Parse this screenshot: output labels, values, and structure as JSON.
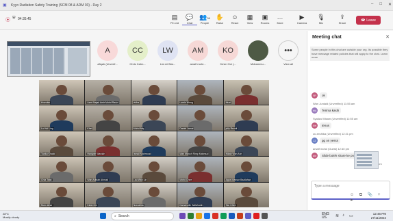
{
  "window": {
    "title": "Kyyo Radiation Safety Training (SCM 08 & ADM 03) - Day 2",
    "min": "–",
    "max": "□",
    "close": "✕"
  },
  "toolbar": {
    "timer": "04:35:45",
    "buttons": [
      {
        "label": "Pin vid",
        "icon": "▤"
      },
      {
        "label": "Chat",
        "icon": "💬"
      },
      {
        "label": "People",
        "icon": "👥"
      },
      {
        "label": "Raise",
        "icon": "✋"
      },
      {
        "label": "React",
        "icon": "☺"
      },
      {
        "label": "View",
        "icon": "▦"
      },
      {
        "label": "Rooms",
        "icon": "▣"
      },
      {
        "label": "More",
        "icon": "…"
      },
      {
        "label": "Camera",
        "icon": "▶"
      },
      {
        "label": "Mic",
        "icon": "🎙"
      },
      {
        "label": "Share",
        "icon": "⇪"
      }
    ],
    "people_count": "36",
    "leave_label": "Leave"
  },
  "avatars": [
    {
      "initials": "A",
      "name": "afiqah (Unverif...",
      "color": "#f8d9d9"
    },
    {
      "initials": "CC",
      "name": "Chris Cahn...",
      "color": "#e4efc9"
    },
    {
      "initials": "LW",
      "name": "Lim Ai War...",
      "color": "#dfe3f3"
    },
    {
      "initials": "AM",
      "name": "amalf mohr...",
      "color": "#f6d8d6"
    },
    {
      "initials": "KO",
      "name": "Kevin Ooi (...",
      "color": "#f6d8d6"
    },
    {
      "initials": "",
      "name": "Mohammu...",
      "color": "#4e5a45"
    },
    {
      "initials": "•••",
      "name": "View all",
      "color": "#f5f5f5"
    }
  ],
  "tiles": [
    "khurulsh",
    "Azmi Najak Amir Mohd Radzi",
    "vidha",
    "Lumin Wong",
    "Muxi",
    "Lu Hui Ling",
    "Khei",
    "Mohd Afiq",
    "Daniel Jamal",
    "juliy Rezidi",
    "Tunku Khalid",
    "Haniyah Wardah",
    "Ismail Mahmood",
    "Man Manoh Rimp Mahmud",
    "Nikah Wan Ann",
    "Chia Tsan",
    "Wan Adibah Ahmad",
    "Lau Wan Lin",
    "Mohd Chee",
    "Agus Mansor Bazilahan",
    "Mun Jahar",
    "Kirah Din",
    "Nurzalina",
    "Kamarudin Sallahudin",
    "Tan Chee"
  ],
  "chat": {
    "title": "Meeting chat",
    "notice": "Some people in this chat are outside your org. Its possible they have message related policies that will apply to the chat. Learn more",
    "messages": [
      {
        "type": "badge",
        "initials": "SR",
        "color": "#c25b7c",
        "text": "ok"
      },
      {
        "type": "meta",
        "text": "Wan Juntaid (Unverified)  11:55 am"
      },
      {
        "type": "bubble",
        "initials": "WA",
        "color": "#9a7bbd",
        "text": "Terima kasih"
      },
      {
        "type": "meta",
        "text": "Syaliza Wisam (Unverified)  11:55 am"
      },
      {
        "type": "bubble",
        "initials": "SW",
        "color": "#c25b7c",
        "text": "tenus"
      },
      {
        "type": "meta",
        "text": "zu zeuhika (Unverified)  12:21 pm"
      },
      {
        "type": "bubble",
        "initials": "ZZ",
        "color": "#6a7fc4",
        "text": "gg on yesss"
      },
      {
        "type": "meta",
        "text": "amalf mohd (Guest)  12:40 pm"
      },
      {
        "type": "bubble",
        "initials": "AM",
        "color": "#c25b7c",
        "text": "Slide boleh share ke pn"
      },
      {
        "type": "meta",
        "text": "12:48 pm"
      }
    ],
    "composer_placeholder": "Type a message",
    "composer_tools": "☺ ⧉ 📎 +  ➤"
  },
  "taskbar": {
    "temp": "28°C",
    "weather": "Mostly cloudy",
    "search": "Search",
    "lang": "ENG",
    "region": "US",
    "time": "12:46 PM",
    "date": "27/11/2024"
  }
}
